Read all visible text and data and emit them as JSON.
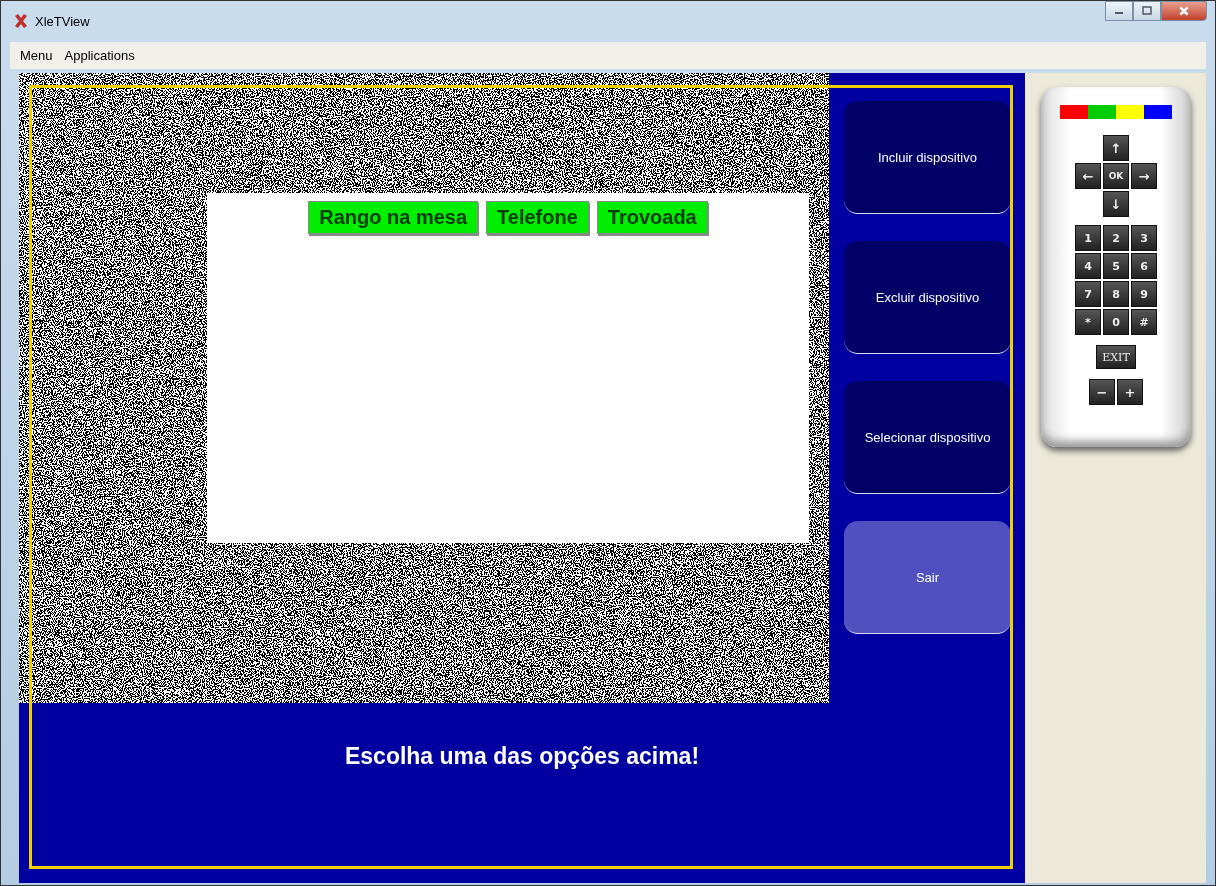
{
  "window": {
    "title": "XleTView"
  },
  "menu": [
    "Menu",
    "Applications"
  ],
  "tv": {
    "options": [
      "Rango na mesa",
      "Telefone",
      "Trovoada"
    ],
    "side_buttons": [
      {
        "label": "Incluir dispositivo",
        "selected": false
      },
      {
        "label": "Excluir dispositivo",
        "selected": false
      },
      {
        "label": "Selecionar dispositivo",
        "selected": false
      },
      {
        "label": "Sair",
        "selected": true
      }
    ],
    "message": "Escolha uma das opções acima!"
  },
  "remote": {
    "color_keys": [
      {
        "color": "#ff0000"
      },
      {
        "color": "#00cc00"
      },
      {
        "color": "#ffff00"
      },
      {
        "color": "#0000ff"
      }
    ],
    "nav_keys": {
      "up": "↑",
      "left": "←",
      "ok": "OK",
      "right": "→",
      "down": "↓"
    },
    "number_keys": [
      "1",
      "2",
      "3",
      "4",
      "5",
      "6",
      "7",
      "8",
      "9",
      "*",
      "0",
      "#"
    ],
    "exit": "EXIT",
    "volume_keys": [
      "−",
      "+"
    ]
  }
}
